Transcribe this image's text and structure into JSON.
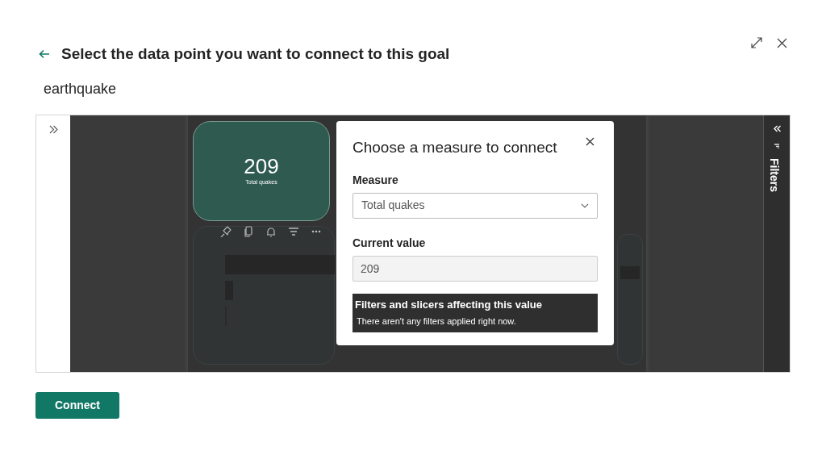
{
  "header": {
    "title": "Select the data point you want to connect to this goal"
  },
  "report_name": "earthquake",
  "report": {
    "card": {
      "value": "209",
      "label": "Total quakes"
    }
  },
  "filters_pane": {
    "label": "Filters"
  },
  "dialog": {
    "title": "Choose a measure to connect",
    "measure": {
      "label": "Measure",
      "value": "Total quakes"
    },
    "current_value": {
      "label": "Current value",
      "value": "209"
    },
    "filters_box": {
      "title": "Filters and slicers affecting this value",
      "message": "There aren't any filters applied right now."
    }
  },
  "buttons": [
    {
      "label": "Connect"
    }
  ]
}
